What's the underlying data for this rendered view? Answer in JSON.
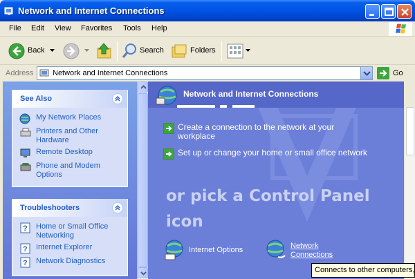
{
  "window": {
    "title": "Network and Internet Connections",
    "accent": "#0055E5"
  },
  "menu": [
    "File",
    "Edit",
    "View",
    "Favorites",
    "Tools",
    "Help"
  ],
  "toolbar": {
    "back_label": "Back",
    "search_label": "Search",
    "folders_label": "Folders"
  },
  "address": {
    "label": "Address",
    "value": "Network and Internet Connections",
    "go_label": "Go"
  },
  "see_also": {
    "title": "See Also",
    "items": [
      {
        "label": "My Network Places",
        "icon": "network-places-icon"
      },
      {
        "label": "Printers and Other Hardware",
        "icon": "printer-icon"
      },
      {
        "label": "Remote Desktop",
        "icon": "remote-desktop-icon"
      },
      {
        "label": "Phone and Modem Options",
        "icon": "phone-modem-icon"
      }
    ]
  },
  "troubleshooters": {
    "title": "Troubleshooters",
    "items": [
      {
        "label": "Home or Small Office Networking",
        "icon": "help-icon"
      },
      {
        "label": "Internet Explorer",
        "icon": "help-icon"
      },
      {
        "label": "Network Diagnostics",
        "icon": "help-icon"
      }
    ]
  },
  "main": {
    "header_title": "Network and Internet Connections",
    "tasks": [
      "Create a connection to the network at your workplace",
      "Set up or change your home or small office network"
    ],
    "pick_text": "or pick a Control Panel icon",
    "icons": [
      {
        "label": "Internet Options",
        "icon": "internet-options-icon"
      },
      {
        "label": "Network Connections",
        "icon": "network-connections-icon"
      }
    ]
  },
  "tooltip": "Connects to other computers,"
}
